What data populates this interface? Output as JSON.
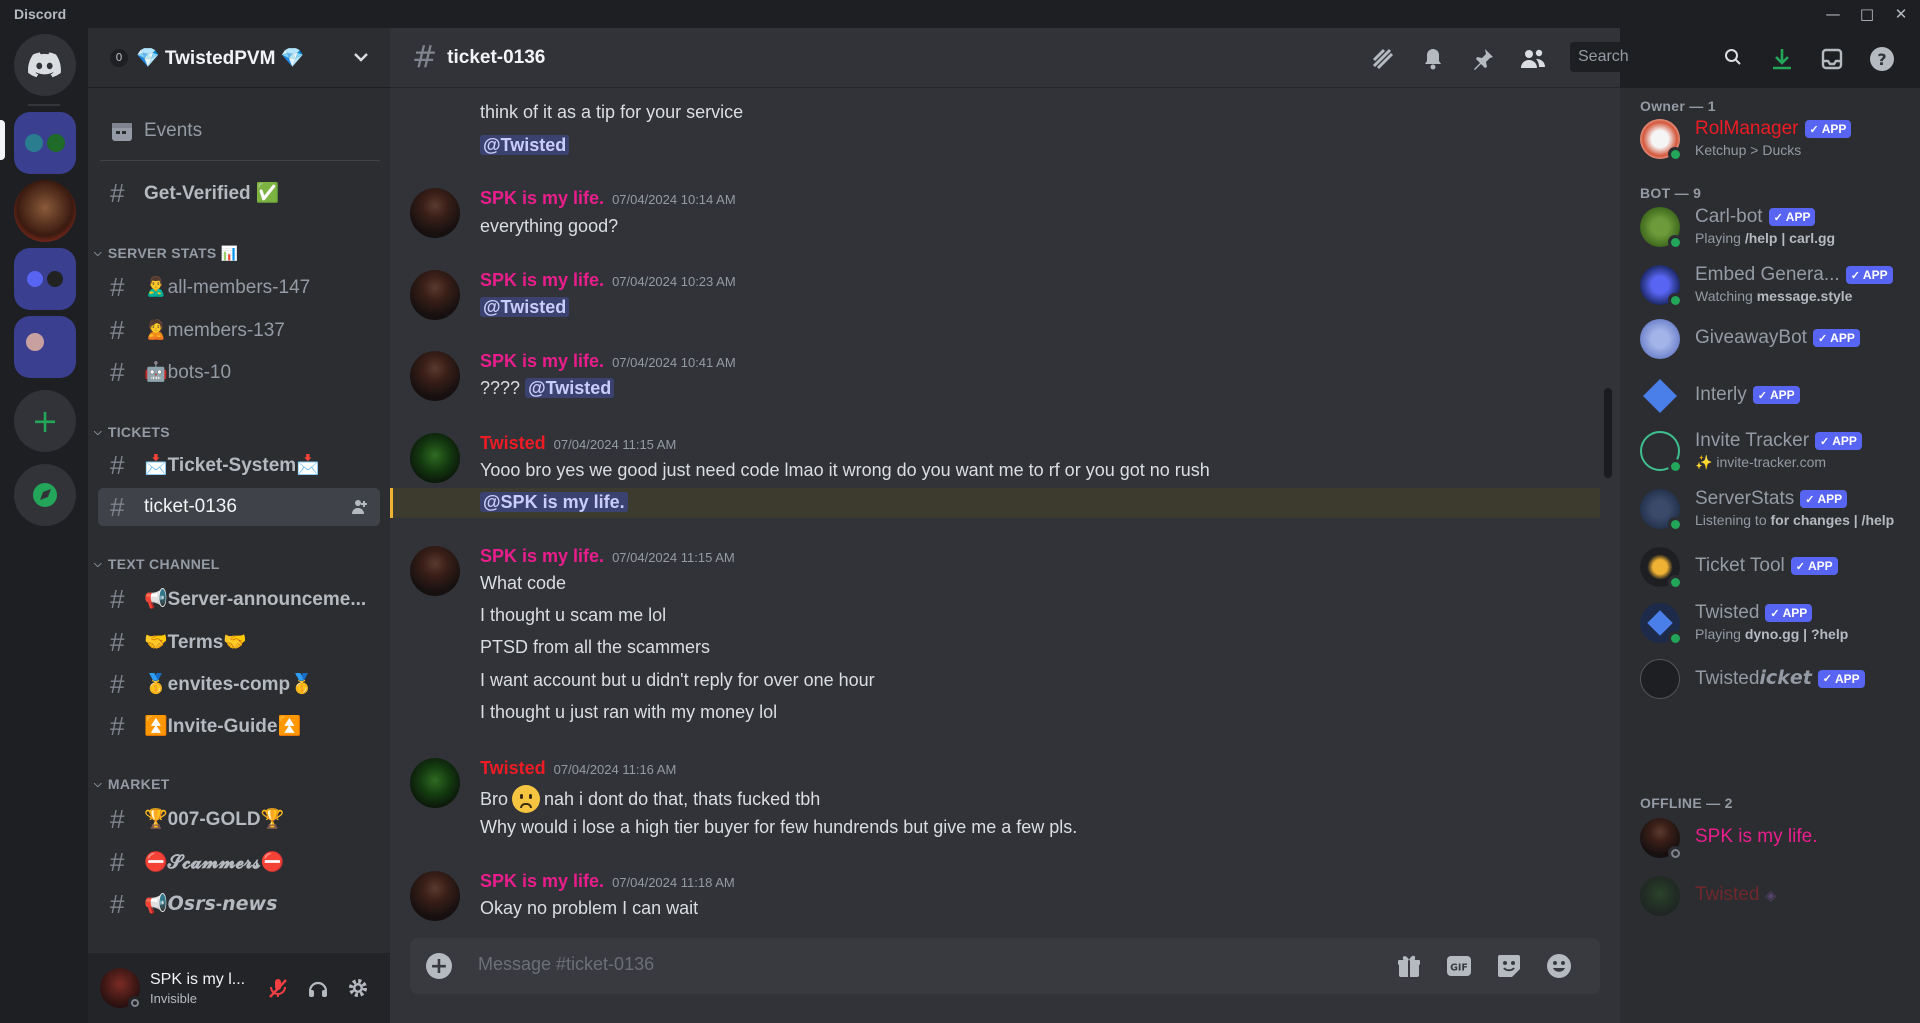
{
  "window": {
    "app_name": "Discord"
  },
  "server": {
    "boost_count": "0",
    "name": "💎 TwistedPVM 💎"
  },
  "sidebar": {
    "events_label": "Events",
    "channels": [
      {
        "label": "Get-Verified ✅",
        "bold": true
      },
      {
        "label": "🙎‍♂️all-members-147"
      },
      {
        "label": "🙎members-137"
      },
      {
        "label": "🤖bots-10"
      },
      {
        "label": "📩Ticket-System📩",
        "bold": true
      },
      {
        "label": "ticket-0136",
        "active": true
      },
      {
        "label": "📢Server-announceme...",
        "bold": true
      },
      {
        "label": "🤝Terms🤝",
        "bold": true
      },
      {
        "label": "🥇envites-comp🥇",
        "bold": true
      },
      {
        "label": "⏫Invite-Guide⏫",
        "bold": true
      },
      {
        "label": "🏆007-GOLD🏆",
        "bold": true
      },
      {
        "label": "⛔𝓢𝓬𝓪𝓶𝓶𝓮𝓻𝓼⛔",
        "bold": true
      },
      {
        "label": "📢𝙊𝙨𝙧𝙨-𝙣𝙚𝙬𝙨",
        "bold": true
      }
    ],
    "categories": [
      "SERVER STATS 📊",
      "TICKETS",
      "TEXT CHANNEL",
      "MARKET"
    ]
  },
  "user_panel": {
    "name": "SPK is my l...",
    "status": "Invisible"
  },
  "channel_header": {
    "title": "ticket-0136",
    "search_placeholder": "Search"
  },
  "messages": [
    {
      "type": "continuation",
      "lines": [
        "think of it as a tip for your service"
      ],
      "mention": "@Twisted"
    },
    {
      "author": "SPK is my life.",
      "author_class": "spk",
      "time": "07/04/2024 10:14 AM",
      "lines": [
        "everything good?"
      ]
    },
    {
      "author": "SPK is my life.",
      "author_class": "spk",
      "time": "07/04/2024 10:23 AM",
      "mention": "@Twisted"
    },
    {
      "author": "SPK is my life.",
      "author_class": "spk",
      "time": "07/04/2024 10:41 AM",
      "text_prefix": "????",
      "mention": "@Twisted"
    },
    {
      "author": "Twisted",
      "author_class": "tw",
      "time": "07/04/2024 11:15 AM",
      "lines": [
        "Yooo bro yes we good just need code lmao it wrong do you want me to rf or you got no rush"
      ],
      "mention": "@SPK is my life."
    },
    {
      "author": "SPK is my life.",
      "author_class": "spk",
      "time": "07/04/2024 11:15 AM",
      "lines": [
        "What code",
        "I thought u scam me lol",
        "PTSD from all the scammers",
        "I want account but u didn't reply for over one hour",
        "I thought u just ran with my money lol"
      ]
    },
    {
      "author": "Twisted",
      "author_class": "tw",
      "time": "07/04/2024 11:16 AM",
      "lines": [
        "Bro",
        "nah i dont do that, thats fucked tbh",
        "Why would i lose a high tier buyer for few hundrends but give me a few pls."
      ]
    },
    {
      "author": "SPK is my life.",
      "author_class": "spk",
      "time": "07/04/2024 11:18 AM",
      "lines": [
        "Okay no problem I can wait"
      ]
    }
  ],
  "composer": {
    "placeholder": "Message #ticket-0136"
  },
  "members": {
    "owner_header": "Owner — 1",
    "bot_header": "BOT — 9",
    "offline_header": "OFFLINE — 2",
    "badge_label": "APP",
    "owner": [
      {
        "name": "RolManager",
        "sub": "Ketchup > Ducks",
        "color": "#ed1c24"
      }
    ],
    "bots": [
      {
        "name": "Carl-bot",
        "sub_prefix": "Playing",
        "sub_bold": "/help | carl.gg"
      },
      {
        "name": "Embed Genera...",
        "sub_prefix": "Watching",
        "sub_bold": "message.style"
      },
      {
        "name": "GiveawayBot"
      },
      {
        "name": "Interly"
      },
      {
        "name": "Invite Tracker",
        "sub_prefix": "✨",
        "sub_bold": "invite-tracker.com"
      },
      {
        "name": "ServerStats",
        "sub_prefix": "Listening to",
        "sub_bold": "for changes | /help"
      },
      {
        "name": "Ticket Tool"
      },
      {
        "name": "Twisted",
        "sub_prefix": "Playing",
        "sub_bold": "dyno.gg | ?help"
      },
      {
        "name": "Twisted𝙞𝙘𝙠𝙚𝙩"
      }
    ],
    "offline": [
      {
        "name": "SPK is my life.",
        "color": "#e91e8c"
      },
      {
        "name": "Twisted",
        "color": "#ed1c24"
      }
    ]
  },
  "colors": {
    "spk": "#e91e8c",
    "twisted": "#ed1c24",
    "accent": "#5865f2",
    "online": "#23a55a"
  },
  "icons": [
    "discord-logo-icon",
    "add-server-icon",
    "discover-icon",
    "calendar-icon",
    "chevron-down-icon",
    "threads-icon",
    "bell-icon",
    "pin-icon",
    "members-icon",
    "search-icon",
    "download-icon",
    "inbox-icon",
    "help-icon",
    "gift-icon",
    "gif-icon",
    "sticker-icon",
    "emoji-icon",
    "mute-mic-icon",
    "headphones-icon",
    "gear-icon",
    "add-member-icon"
  ]
}
